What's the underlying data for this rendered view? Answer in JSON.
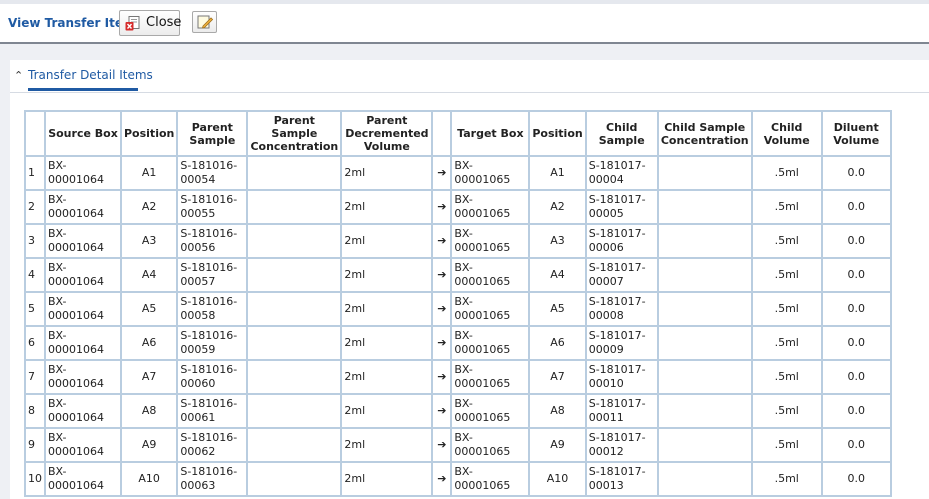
{
  "toolbar": {
    "title": "View Transfer Items",
    "close_label": "Close",
    "close_icon": "close-document-icon",
    "edit_icon": "note-edit-icon"
  },
  "section": {
    "title": "Transfer Detail Items",
    "toggle_icon": "chevron-up-icon"
  },
  "colors": {
    "accent": "#1f5aa3",
    "grid_border": "#b9cde0",
    "panel_bg": "#eef0f4"
  },
  "table": {
    "columns": [
      "",
      "Source Box",
      "Position",
      "Parent Sample",
      "Parent Sample Concentration",
      "Parent Decremented Volume",
      "",
      "Target Box",
      "Position",
      "Child Sample",
      "Child Sample Concentration",
      "Child Volume",
      "Diluent Volume"
    ],
    "arrow_glyph": "➔",
    "rows": [
      {
        "num": "1",
        "source_box": "BX-00001064",
        "source_pos": "A1",
        "parent_sample": "S-181016-00054",
        "parent_conc": "",
        "parent_dec_vol": "2ml",
        "target_box": "BX-00001065",
        "target_pos": "A1",
        "child_sample": "S-181017-00004",
        "child_conc": "",
        "child_vol": ".5ml",
        "diluent_vol": "0.0"
      },
      {
        "num": "2",
        "source_box": "BX-00001064",
        "source_pos": "A2",
        "parent_sample": "S-181016-00055",
        "parent_conc": "",
        "parent_dec_vol": "2ml",
        "target_box": "BX-00001065",
        "target_pos": "A2",
        "child_sample": "S-181017-00005",
        "child_conc": "",
        "child_vol": ".5ml",
        "diluent_vol": "0.0"
      },
      {
        "num": "3",
        "source_box": "BX-00001064",
        "source_pos": "A3",
        "parent_sample": "S-181016-00056",
        "parent_conc": "",
        "parent_dec_vol": "2ml",
        "target_box": "BX-00001065",
        "target_pos": "A3",
        "child_sample": "S-181017-00006",
        "child_conc": "",
        "child_vol": ".5ml",
        "diluent_vol": "0.0"
      },
      {
        "num": "4",
        "source_box": "BX-00001064",
        "source_pos": "A4",
        "parent_sample": "S-181016-00057",
        "parent_conc": "",
        "parent_dec_vol": "2ml",
        "target_box": "BX-00001065",
        "target_pos": "A4",
        "child_sample": "S-181017-00007",
        "child_conc": "",
        "child_vol": ".5ml",
        "diluent_vol": "0.0"
      },
      {
        "num": "5",
        "source_box": "BX-00001064",
        "source_pos": "A5",
        "parent_sample": "S-181016-00058",
        "parent_conc": "",
        "parent_dec_vol": "2ml",
        "target_box": "BX-00001065",
        "target_pos": "A5",
        "child_sample": "S-181017-00008",
        "child_conc": "",
        "child_vol": ".5ml",
        "diluent_vol": "0.0"
      },
      {
        "num": "6",
        "source_box": "BX-00001064",
        "source_pos": "A6",
        "parent_sample": "S-181016-00059",
        "parent_conc": "",
        "parent_dec_vol": "2ml",
        "target_box": "BX-00001065",
        "target_pos": "A6",
        "child_sample": "S-181017-00009",
        "child_conc": "",
        "child_vol": ".5ml",
        "diluent_vol": "0.0"
      },
      {
        "num": "7",
        "source_box": "BX-00001064",
        "source_pos": "A7",
        "parent_sample": "S-181016-00060",
        "parent_conc": "",
        "parent_dec_vol": "2ml",
        "target_box": "BX-00001065",
        "target_pos": "A7",
        "child_sample": "S-181017-00010",
        "child_conc": "",
        "child_vol": ".5ml",
        "diluent_vol": "0.0"
      },
      {
        "num": "8",
        "source_box": "BX-00001064",
        "source_pos": "A8",
        "parent_sample": "S-181016-00061",
        "parent_conc": "",
        "parent_dec_vol": "2ml",
        "target_box": "BX-00001065",
        "target_pos": "A8",
        "child_sample": "S-181017-00011",
        "child_conc": "",
        "child_vol": ".5ml",
        "diluent_vol": "0.0"
      },
      {
        "num": "9",
        "source_box": "BX-00001064",
        "source_pos": "A9",
        "parent_sample": "S-181016-00062",
        "parent_conc": "",
        "parent_dec_vol": "2ml",
        "target_box": "BX-00001065",
        "target_pos": "A9",
        "child_sample": "S-181017-00012",
        "child_conc": "",
        "child_vol": ".5ml",
        "diluent_vol": "0.0"
      },
      {
        "num": "10",
        "source_box": "BX-00001064",
        "source_pos": "A10",
        "parent_sample": "S-181016-00063",
        "parent_conc": "",
        "parent_dec_vol": "2ml",
        "target_box": "BX-00001065",
        "target_pos": "A10",
        "child_sample": "S-181017-00013",
        "child_conc": "",
        "child_vol": ".5ml",
        "diluent_vol": "0.0"
      }
    ]
  }
}
